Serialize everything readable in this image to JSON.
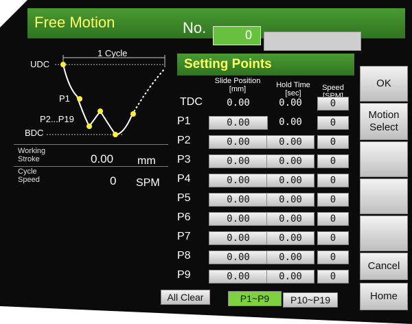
{
  "header": {
    "title": "Free Motion",
    "no_label": "No.",
    "no_value": "0"
  },
  "diagram": {
    "cycle_label": "1 Cycle",
    "udc": "UDC",
    "p1": "P1",
    "p2_p19": "P2...P19",
    "bdc": "BDC"
  },
  "info": {
    "working_stroke_label_1": "Working",
    "working_stroke_label_2": "Stroke",
    "working_stroke_value": "0.00",
    "working_stroke_unit": "mm",
    "cycle_speed_label_1": "Cycle",
    "cycle_speed_label_2": "Speed",
    "cycle_speed_value": "0",
    "cycle_speed_unit": "SPM"
  },
  "setting_points": {
    "title": "Setting Points",
    "col_slide_1": "Slide Position",
    "col_slide_2": "[mm]",
    "col_hold_1": "Hold Time",
    "col_hold_2": "[sec]",
    "col_speed_1": "Speed",
    "col_speed_2": "[SPM]",
    "rows": [
      {
        "label": "TDC",
        "pos": "0.00",
        "hold": "0.00",
        "speed": "0"
      },
      {
        "label": "P1",
        "pos": "0.00",
        "hold": "0.00",
        "speed": "0"
      },
      {
        "label": "P2",
        "pos": "0.00",
        "hold": "0.00",
        "speed": "0"
      },
      {
        "label": "P3",
        "pos": "0.00",
        "hold": "0.00",
        "speed": "0"
      },
      {
        "label": "P4",
        "pos": "0.00",
        "hold": "0.00",
        "speed": "0"
      },
      {
        "label": "P5",
        "pos": "0.00",
        "hold": "0.00",
        "speed": "0"
      },
      {
        "label": "P6",
        "pos": "0.00",
        "hold": "0.00",
        "speed": "0"
      },
      {
        "label": "P7",
        "pos": "0.00",
        "hold": "0.00",
        "speed": "0"
      },
      {
        "label": "P8",
        "pos": "0.00",
        "hold": "0.00",
        "speed": "0"
      },
      {
        "label": "P9",
        "pos": "0.00",
        "hold": "0.00",
        "speed": "0"
      }
    ]
  },
  "buttons": {
    "ok": "OK",
    "motion_select_1": "Motion",
    "motion_select_2": "Select",
    "cancel": "Cancel",
    "home": "Home",
    "all_clear": "All Clear",
    "page_1": "P1~P9",
    "page_2": "P10~P19"
  },
  "colors": {
    "accent_green": "#2f7420",
    "title_yellow": "#ffff66",
    "active_tab": "#7ed23f"
  }
}
